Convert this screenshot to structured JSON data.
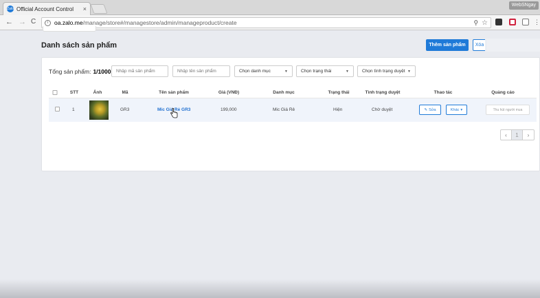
{
  "browser": {
    "tab_title": "Official Account Control",
    "tab_close": "×",
    "favicon_text": "Zalo",
    "profile_badge": "WebSNgay",
    "nav_back": "←",
    "nav_forward": "→",
    "nav_reload": "C",
    "url_domain": "oa.zalo.me",
    "url_path": "/manage/store#/managestore/admin/manageproduct/create",
    "zoom_icon": "⚲",
    "star_icon": "☆"
  },
  "page": {
    "title": "Danh sách sản phẩm",
    "add_button": "Thêm sản phẩm",
    "delete_button": "Xóa"
  },
  "filters": {
    "total_label": "Tổng sản phẩm:",
    "total_value": "1/1000",
    "code_placeholder": "Nhập mã sản phẩm",
    "name_placeholder": "Nhập tên sản phẩm",
    "category": "Chọn danh mục",
    "status": "Chọn trạng thái",
    "review_status": "Chọn tình trạng duyệt"
  },
  "table": {
    "headers": [
      "STT",
      "Ảnh",
      "Mã",
      "Tên sản phẩm",
      "Giá (VNĐ)",
      "Danh mục",
      "Trạng thái",
      "Tình trạng duyệt",
      "Thao tác",
      "Quảng cáo"
    ],
    "rows": [
      {
        "stt": "1",
        "code": "GR3",
        "name": "Mic Giá Rẻ GR3",
        "price": "199,000",
        "category": "Mic Giá Rẻ",
        "status": "Hiện",
        "review": "Chờ duyệt",
        "edit_label": "Sửa",
        "more_label": "Khác",
        "ad_placeholder": "Thu hút người mua"
      }
    ]
  },
  "pagination": {
    "prev": "‹",
    "current": "1",
    "next": "›"
  },
  "colors": {
    "accent": "#1f7ad8",
    "row_bg": "#f0f4fb"
  }
}
